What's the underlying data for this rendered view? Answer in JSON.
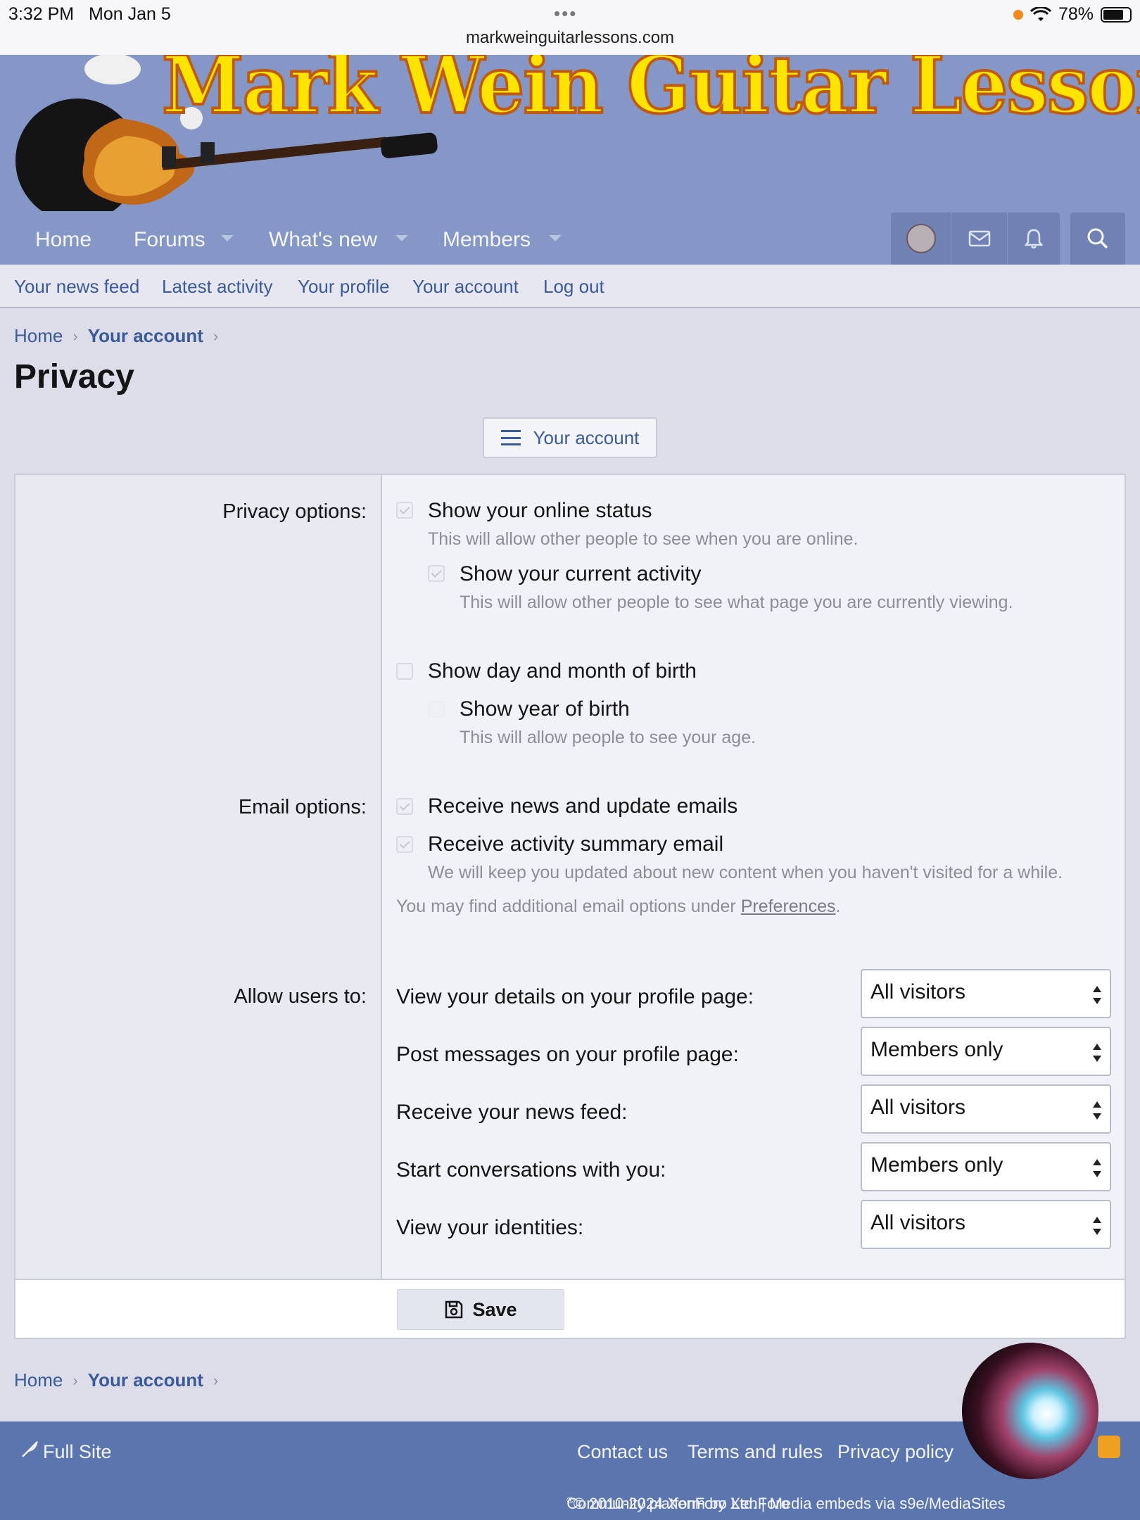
{
  "statusbar": {
    "time": "3:32 PM",
    "date": "Mon Jan 5",
    "dots": "•••",
    "url": "markweinguitarlessons.com",
    "battery": "78%"
  },
  "header": {
    "logo_text": "Mark Wein Guitar Lessons .com"
  },
  "nav": {
    "items": [
      {
        "label": "Home"
      },
      {
        "label": "Forums"
      },
      {
        "label": "What's new"
      },
      {
        "label": "Members"
      }
    ],
    "icons": [
      "avatar",
      "mail-icon",
      "bell-icon",
      "search-icon"
    ]
  },
  "subnav": {
    "items": [
      "Your news feed",
      "Latest activity",
      "Your profile",
      "Your account",
      "Log out"
    ]
  },
  "breadcrumb": {
    "home": "Home",
    "current": "Your account"
  },
  "page": {
    "title": "Privacy",
    "account_button": "Your account"
  },
  "form": {
    "privacy_label": "Privacy options:",
    "online_status": {
      "label": "Show your online status",
      "hint": "This will allow other people to see when you are online.",
      "checked": true
    },
    "current_activity": {
      "label": "Show your current activity",
      "hint": "This will allow other people to see what page you are currently viewing.",
      "checked": true
    },
    "dob": {
      "label": "Show day and month of birth",
      "checked": false
    },
    "yob": {
      "label": "Show year of birth",
      "hint": "This will allow people to see your age.",
      "checked": false
    },
    "email_label": "Email options:",
    "news_emails": {
      "label": "Receive news and update emails",
      "checked": true
    },
    "summary_email": {
      "label": "Receive activity summary email",
      "hint": "We will keep you updated about new content when you haven't visited for a while.",
      "checked": true
    },
    "email_note_prefix": "You may find additional email options under ",
    "email_note_link": "Preferences",
    "email_note_suffix": ".",
    "allow_label": "Allow users to:",
    "allow_rows": [
      {
        "label": "View your details on your profile page:",
        "value": "All visitors"
      },
      {
        "label": "Post messages on your profile page:",
        "value": "Members only"
      },
      {
        "label": "Receive your news feed:",
        "value": "All visitors"
      },
      {
        "label": "Start conversations with you:",
        "value": "Members only"
      },
      {
        "label": "View your identities:",
        "value": "All visitors"
      }
    ],
    "save_label": "Save"
  },
  "footer": {
    "full_site": "Full Site",
    "links": [
      "Contact us",
      "Terms and rules",
      "Privacy policy"
    ],
    "copyright_prefix": "Community platform by XenForo",
    "copyright_reg": "®",
    "copyright_suffix": " © 2010-2024 XenForo Ltd. | Media embeds via s9e/MediaSites"
  },
  "colors": {
    "nav": "#8497c6",
    "footer": "#5b76ae",
    "link": "#3a5a99",
    "logo": "#ffe400"
  }
}
